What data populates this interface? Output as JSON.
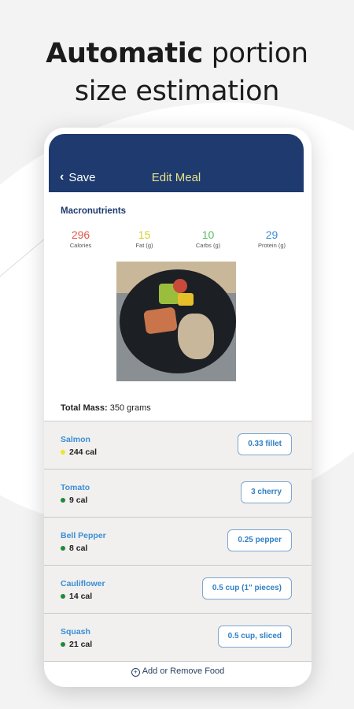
{
  "headline": {
    "bold": "Automatic",
    "line1_rest": " portion",
    "line2": "size estimation"
  },
  "header": {
    "back_label": "Save",
    "title": "Edit Meal"
  },
  "macros": {
    "title": "Macronutrients",
    "items": [
      {
        "value": "296",
        "label": "Calories",
        "color": "#e0574f"
      },
      {
        "value": "15",
        "label": "Fat (g)",
        "color": "#d7d030"
      },
      {
        "value": "10",
        "label": "Carbs (g)",
        "color": "#5cbd63"
      },
      {
        "value": "29",
        "label": "Protein (g)",
        "color": "#3a8ed6"
      }
    ]
  },
  "total_mass": {
    "label": "Total Mass:",
    "value": "350 grams"
  },
  "foods": [
    {
      "name": "Salmon",
      "cal": "244 cal",
      "dot": "#f0e52a",
      "portion": "0.33 fillet"
    },
    {
      "name": "Tomato",
      "cal": "9 cal",
      "dot": "#1f8a3a",
      "portion": "3 cherry"
    },
    {
      "name": "Bell Pepper",
      "cal": "8 cal",
      "dot": "#1f8a3a",
      "portion": "0.25 pepper"
    },
    {
      "name": "Cauliflower",
      "cal": "14 cal",
      "dot": "#1f8a3a",
      "portion": "0.5 cup (1\" pieces)"
    },
    {
      "name": "Squash",
      "cal": "21 cal",
      "dot": "#1f8a3a",
      "portion": "0.5 cup, sliced"
    }
  ],
  "add_remove_label": "Add or Remove Food"
}
